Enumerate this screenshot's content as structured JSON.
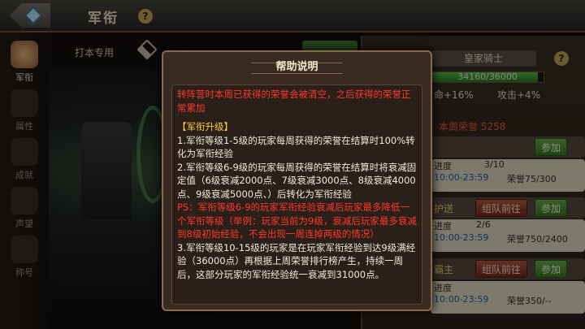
{
  "header": {
    "title": "军衔",
    "help": "?"
  },
  "sidebar": {
    "items": [
      {
        "label": "军衔"
      },
      {
        "label": "属性"
      },
      {
        "label": "成就"
      },
      {
        "label": "声望"
      },
      {
        "label": "称号"
      }
    ]
  },
  "tab": {
    "label": "打本专用"
  },
  "rank": {
    "name": "皇家骑士",
    "exp_text": "34160/36000",
    "exp_fraction": 0.9489,
    "bonus_left": "命+16%",
    "bonus_right": "攻击+4%",
    "weekly_honor": "本周荣誉 5258"
  },
  "activities": [
    {
      "title": "",
      "progress": "进度",
      "progress_val": "3/10",
      "time": "10:00-23:59",
      "honor": "荣誉75/300",
      "join": "参加"
    },
    {
      "title": "护送",
      "progress": "进度",
      "progress_val": "2/6",
      "time": "10:00-23:59",
      "honor": "荣誉750/2400",
      "team": "组队前往",
      "join": "参加"
    },
    {
      "title": "霸主",
      "progress": "进度",
      "time": "10:00-23:59",
      "honor": "荣誉350/--",
      "team": "组队前往",
      "join": "参加"
    }
  ],
  "dialog": {
    "title": "帮助说明",
    "intro": "转阵营时本周已获得的荣誉会被清空，之后获得的荣誉正常累加",
    "section": "【军衔升级】",
    "rule1": "1.军衔等级1-5级的玩家每周获得的荣誉在结算时100%转化为军衔经验",
    "rule2": "2.军衔等级6-9级的玩家每周获得的荣誉在结算时将衰减固定值（6级衰减2000点、7级衰减3000点、8级衰减4000点、9级衰减5000点、）后转化为军衔经验",
    "ps": "PS：军衔等级6-9的玩家军衔经验衰减后玩家最多降低一个军衔等级（举例：玩家当前为9级，衰减后玩家最多衰减到8级初始经验，不会出现一周连掉两级的情况）",
    "rule3": "3.军衔等级10-15级的玩家是在玩家军衔经验到达9级满经验（36000点）再根据上周荣誉排行榜产生，持续一周后，这部分玩家的军衔经验统一衰减到31000点。"
  }
}
